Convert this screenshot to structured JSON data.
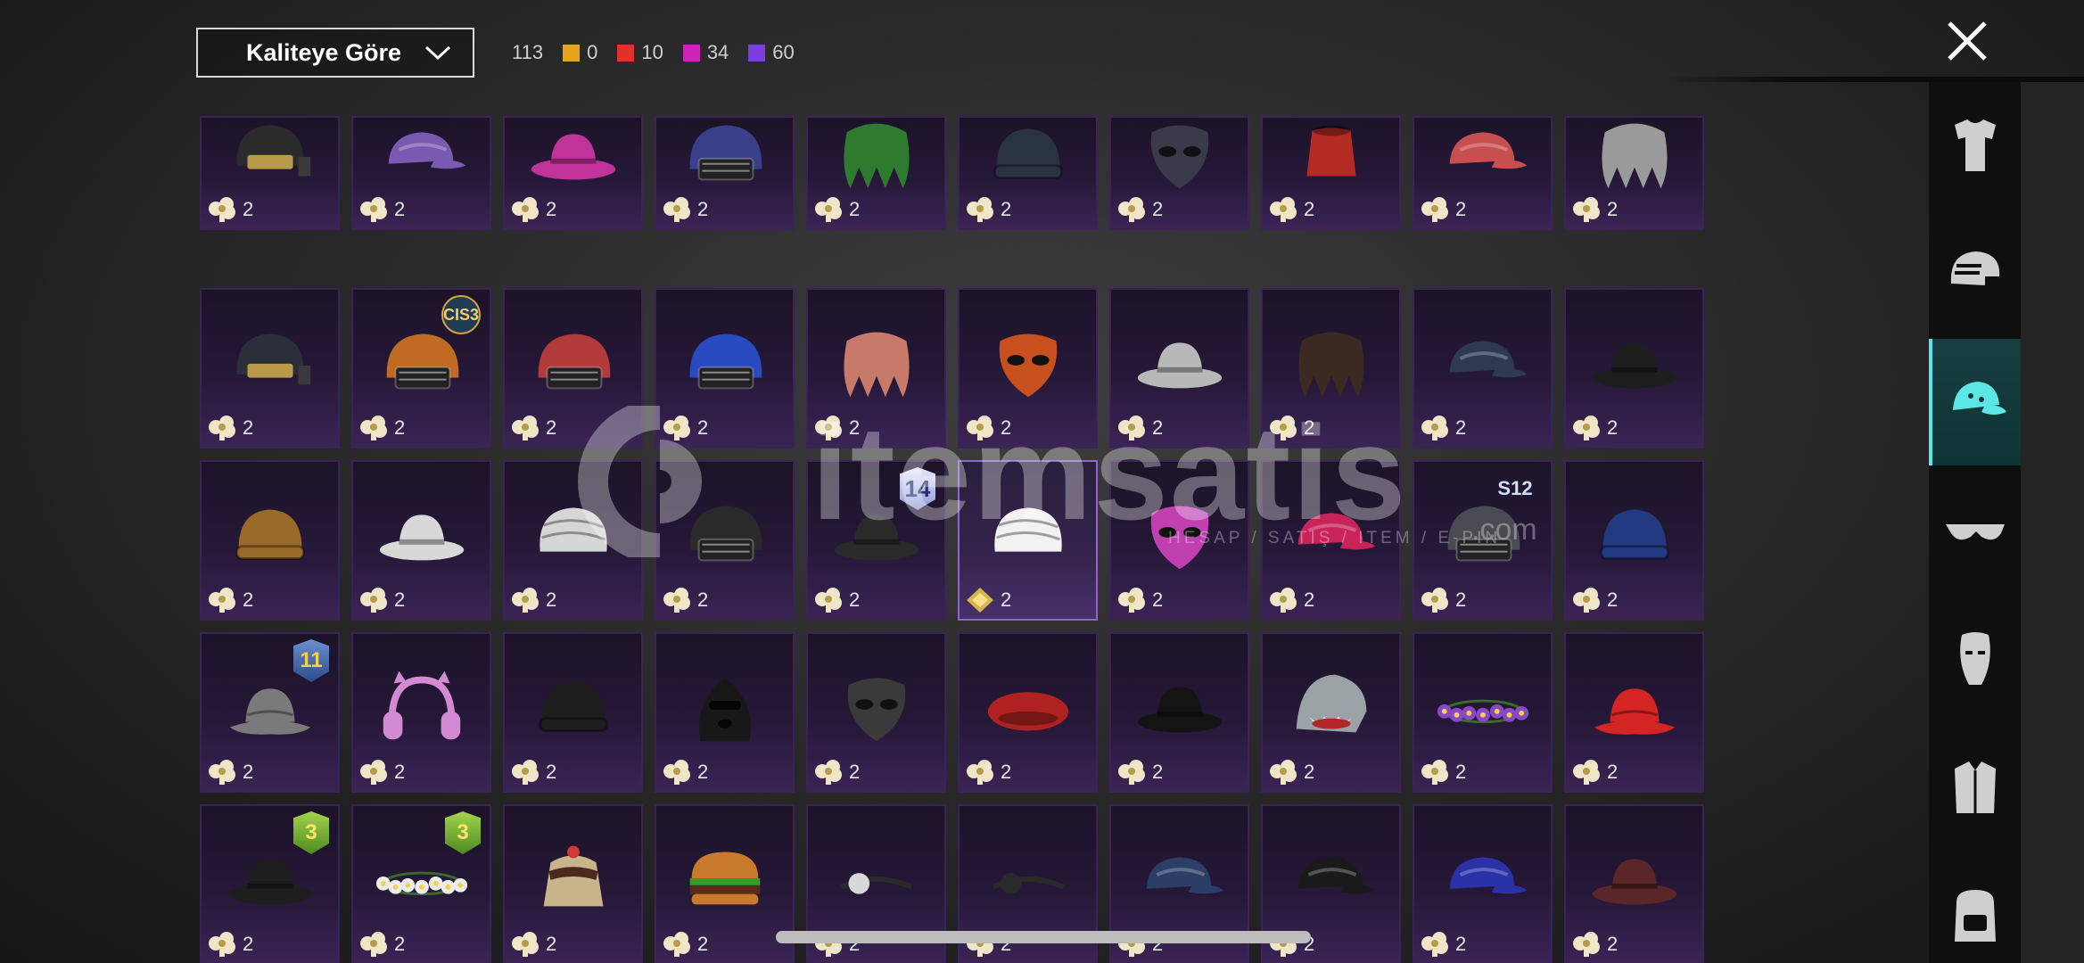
{
  "sort": {
    "label": "Kaliteye Göre"
  },
  "stats": {
    "total": "113",
    "counts": [
      {
        "color": "#e8a31e",
        "value": "0"
      },
      {
        "color": "#e0322b",
        "value": "10"
      },
      {
        "color": "#cc24b8",
        "value": "34"
      },
      {
        "color": "#7a3ee0",
        "value": "60"
      }
    ]
  },
  "watermark": {
    "brand": "itemsatis",
    "tagline": "HESAP / SATIŞ / ITEM / E-PIN",
    "domain": ".com"
  },
  "sidebar": {
    "tabs": [
      {
        "name": "outfit-icon",
        "active": false
      },
      {
        "name": "helmet-icon",
        "active": false
      },
      {
        "name": "cap-icon",
        "active": true
      },
      {
        "name": "glasses-icon",
        "active": false
      },
      {
        "name": "mask-icon",
        "active": false
      },
      {
        "name": "jacket-icon",
        "active": false
      },
      {
        "name": "backpack-icon",
        "active": false
      }
    ]
  },
  "items": [
    {
      "icon": "tactical-helmet-icon",
      "color": "#2b2b2b",
      "qty": "2"
    },
    {
      "icon": "cap-icon",
      "color": "#7a5ab0",
      "qty": "2"
    },
    {
      "icon": "hat-icon",
      "color": "#c0339a",
      "qty": "2"
    },
    {
      "icon": "helmet-icon",
      "color": "#3a3f8a",
      "qty": "2"
    },
    {
      "icon": "hair-icon",
      "color": "#2e7a2e",
      "qty": "2"
    },
    {
      "icon": "beanie-icon",
      "color": "#2a3344",
      "qty": "2"
    },
    {
      "icon": "mask-icon",
      "color": "#3a3a4a",
      "qty": "2"
    },
    {
      "icon": "fez-icon",
      "color": "#b42a24",
      "qty": "2"
    },
    {
      "icon": "cap-icon",
      "color": "#c84f4f",
      "qty": "2"
    },
    {
      "icon": "hair-icon",
      "color": "#9a9a9a",
      "qty": "2"
    },
    {
      "icon": "tactical-helmet-icon",
      "color": "#2b2f3a",
      "qty": "2"
    },
    {
      "icon": "helmet-icon",
      "color": "#c06a24",
      "qty": "2",
      "badge": "CIS3",
      "badgeType": "tag"
    },
    {
      "icon": "helmet-icon",
      "color": "#b23a3a",
      "qty": "2"
    },
    {
      "icon": "helmet-icon",
      "color": "#2a4ac0",
      "qty": "2"
    },
    {
      "icon": "hair-icon",
      "color": "#c87a6a",
      "qty": "2"
    },
    {
      "icon": "mask-icon",
      "color": "#c8501e",
      "qty": "2"
    },
    {
      "icon": "hat-icon",
      "color": "#b8b8b8",
      "qty": "2"
    },
    {
      "icon": "hair-icon",
      "color": "#3a2a22",
      "qty": "2"
    },
    {
      "icon": "cap-icon",
      "color": "#2e3a52",
      "qty": "2"
    },
    {
      "icon": "hat-icon",
      "color": "#1e1e1e",
      "qty": "2"
    },
    {
      "icon": "beanie-icon",
      "color": "#9a6a2a",
      "qty": "2"
    },
    {
      "icon": "hat-icon",
      "color": "#d8d8d8",
      "qty": "2"
    },
    {
      "icon": "turban-icon",
      "color": "#d6d6d6",
      "qty": "2"
    },
    {
      "icon": "helmet-icon",
      "color": "#2a2a2a",
      "qty": "2"
    },
    {
      "icon": "hat-icon",
      "color": "#2a2a2a",
      "qty": "2",
      "badge": "14",
      "badgeType": "num14"
    },
    {
      "icon": "turban-icon",
      "color": "#f2f2f2",
      "qty": "2",
      "selected": true,
      "coin": "gold"
    },
    {
      "icon": "mask-icon",
      "color": "#c040b0",
      "qty": "2"
    },
    {
      "icon": "cap-icon",
      "color": "#c8245a",
      "qty": "2"
    },
    {
      "icon": "helmet-icon",
      "color": "#4a4a52",
      "qty": "2",
      "badge": "S12",
      "badgeType": "s12"
    },
    {
      "icon": "beanie-icon",
      "color": "#223a82",
      "qty": "2"
    },
    {
      "icon": "bucket-hat-icon",
      "color": "#7a7a7a",
      "qty": "2",
      "badge": "11",
      "badgeType": "season"
    },
    {
      "icon": "headphones-icon",
      "color": "#d28ad2",
      "qty": "2"
    },
    {
      "icon": "beanie-icon",
      "color": "#1e1e1e",
      "qty": "2"
    },
    {
      "icon": "balaclava-icon",
      "color": "#181818",
      "qty": "2"
    },
    {
      "icon": "mask-icon",
      "color": "#3a3a3a",
      "qty": "2"
    },
    {
      "icon": "beret-icon",
      "color": "#b02222",
      "qty": "2"
    },
    {
      "icon": "hat-icon",
      "color": "#141414",
      "qty": "2"
    },
    {
      "icon": "shark-hat-icon",
      "color": "#9aa2a6",
      "qty": "2"
    },
    {
      "icon": "flower-crown-icon",
      "color": "#8a48c8",
      "qty": "2"
    },
    {
      "icon": "bucket-hat-icon",
      "color": "#d42424",
      "qty": "2"
    },
    {
      "icon": "hat-icon",
      "color": "#1e1e1e",
      "qty": "2",
      "badge": "3",
      "badgeType": "green"
    },
    {
      "icon": "flower-crown-icon",
      "color": "#ececec",
      "qty": "2",
      "badge": "3",
      "badgeType": "green"
    },
    {
      "icon": "cake-hat-icon",
      "color": "#c8b48a",
      "qty": "2"
    },
    {
      "icon": "burger-hat-icon",
      "color": "#c87a2a",
      "qty": "2"
    },
    {
      "icon": "headband-icon",
      "color": "#d8d8d8",
      "qty": "2"
    },
    {
      "icon": "headband-icon",
      "color": "#2a2a2a",
      "qty": "2"
    },
    {
      "icon": "cap-icon",
      "color": "#2a3e66",
      "qty": "2"
    },
    {
      "icon": "cap-icon",
      "color": "#1a1a1a",
      "qty": "2"
    },
    {
      "icon": "cap-icon",
      "color": "#2a32a8",
      "qty": "2"
    },
    {
      "icon": "hat-icon",
      "color": "#5a2628",
      "qty": "2"
    }
  ]
}
